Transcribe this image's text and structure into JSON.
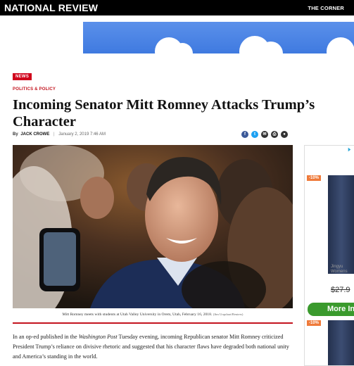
{
  "site": {
    "brand": "NATIONAL REVIEW",
    "corner_link": "THE CORNER"
  },
  "article": {
    "tag": "NEWS",
    "section": "POLITICS & POLICY",
    "headline": "Incoming Senator Mitt Romney Attacks Trump’s Character",
    "by_label": "By",
    "author": "JACK CROWE",
    "date": "January 2, 2019 7:46 AM",
    "caption": "Mitt Romney meets with students at Utah Valley University in Orem, Utah, February 16, 2018.",
    "photo_credit": "(Jim Urquhart/Reuters)",
    "body_intro": "In an op-ed published in the ",
    "body_pub": "Washington Post",
    "body_rest": " Tuesday evening, incoming Republican senator Mitt Romney criticized President Trump’s reliance on divisive rhetoric and suggested that his character flaws have degraded both national unity and America’s standing in the world."
  },
  "share": [
    {
      "icon": "facebook-icon",
      "glyph": "f",
      "color": "#3b5998"
    },
    {
      "icon": "twitter-icon",
      "glyph": "t",
      "color": "#1da1f2"
    },
    {
      "icon": "email-icon",
      "glyph": "✉",
      "color": "#333333"
    },
    {
      "icon": "print-icon",
      "glyph": "⎙",
      "color": "#333333"
    },
    {
      "icon": "comments-icon",
      "glyph": "●",
      "color": "#333333"
    }
  ],
  "sidebar_ad": {
    "badge_1": "-10%",
    "brand_1": "Jingyu",
    "brand_2": "Womens",
    "price": "$27.9",
    "button": "More In",
    "badge_2": "-10%"
  },
  "colors": {
    "accent": "#c3141e",
    "news_tag": "#d0011b",
    "button_green": "#3a9a2d",
    "badge_orange": "#ef7a3a"
  }
}
